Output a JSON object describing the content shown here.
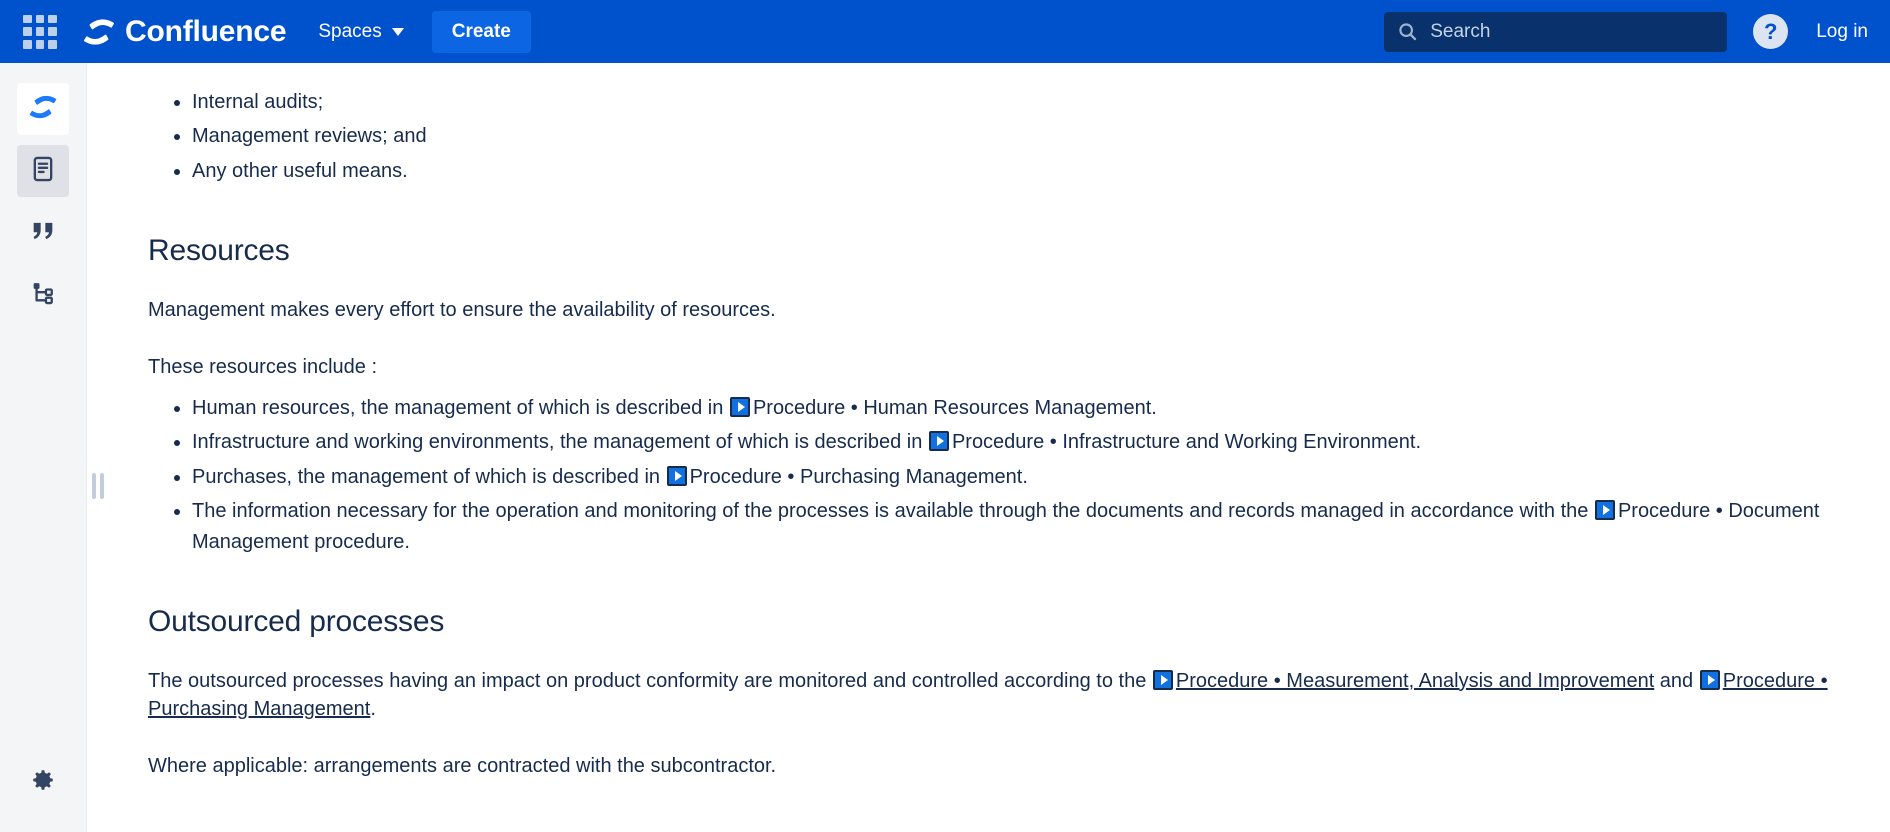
{
  "topnav": {
    "app_switcher_icon": "grid-apps-icon",
    "brand_logo_icon": "confluence-logo-icon",
    "brand_name": "Confluence",
    "spaces_label": "Spaces",
    "spaces_chevron_icon": "chevron-down-icon",
    "create_label": "Create",
    "search": {
      "icon": "search-icon",
      "placeholder": "Search",
      "value": ""
    },
    "help_icon": "question-mark-icon",
    "help_label": "?",
    "login_label": "Log in",
    "colors": {
      "nav_background": "#0051cc",
      "create_button": "#0c66e4",
      "search_background": "#09326c"
    }
  },
  "rail": {
    "items": [
      {
        "name": "confluence-logo",
        "icon": "confluence-logo-icon",
        "active": false
      },
      {
        "name": "pages",
        "icon": "page-document-icon",
        "active": true
      },
      {
        "name": "blog",
        "icon": "quote-icon",
        "active": false
      },
      {
        "name": "page-tree",
        "icon": "page-tree-icon",
        "active": false
      }
    ],
    "bottom_item": {
      "name": "settings",
      "icon": "gear-icon"
    },
    "resize_handle_icon": "drag-handle-icon"
  },
  "content": {
    "top_list": [
      "Internal audits;",
      "Management reviews; and",
      "Any other useful means."
    ],
    "resources": {
      "heading": "Resources",
      "paragraph_1": "Management makes every effort to ensure the availability of resources.",
      "paragraph_2": "These resources include :",
      "items": [
        {
          "prefix": "Human resources, the management of which is described in ",
          "link_icon": "page-link-icon",
          "link": "Procedure • Human Resources Management",
          "suffix": "."
        },
        {
          "prefix": "Infrastructure and working environments, the management of which is described in ",
          "link_icon": "page-link-icon",
          "link": "Procedure • Infrastructure and Working Environment",
          "suffix": "."
        },
        {
          "prefix": "Purchases, the management of which is described in ",
          "link_icon": "page-link-icon",
          "link": "Procedure • Purchasing Management",
          "suffix": "."
        },
        {
          "prefix": "The information necessary for the operation and monitoring of the processes is available through the documents and records managed in accordance with the ",
          "link_icon": "page-link-icon",
          "link": "Procedure • Document Management",
          "suffix": " procedure."
        }
      ]
    },
    "outsourced": {
      "heading": "Outsourced processes",
      "paragraph_prefix": "The outsourced processes having an impact on product conformity are monitored and controlled according to the ",
      "link_1_icon": "page-link-icon",
      "link_1": "Procedure • Measurement, Analysis and Improvement",
      "paragraph_middle": " and ",
      "link_2_icon": "page-link-icon",
      "link_2": "Procedure • Purchasing Management",
      "paragraph_suffix": ".",
      "paragraph_2": "Where applicable: arrangements are contracted with the subcontractor."
    }
  }
}
